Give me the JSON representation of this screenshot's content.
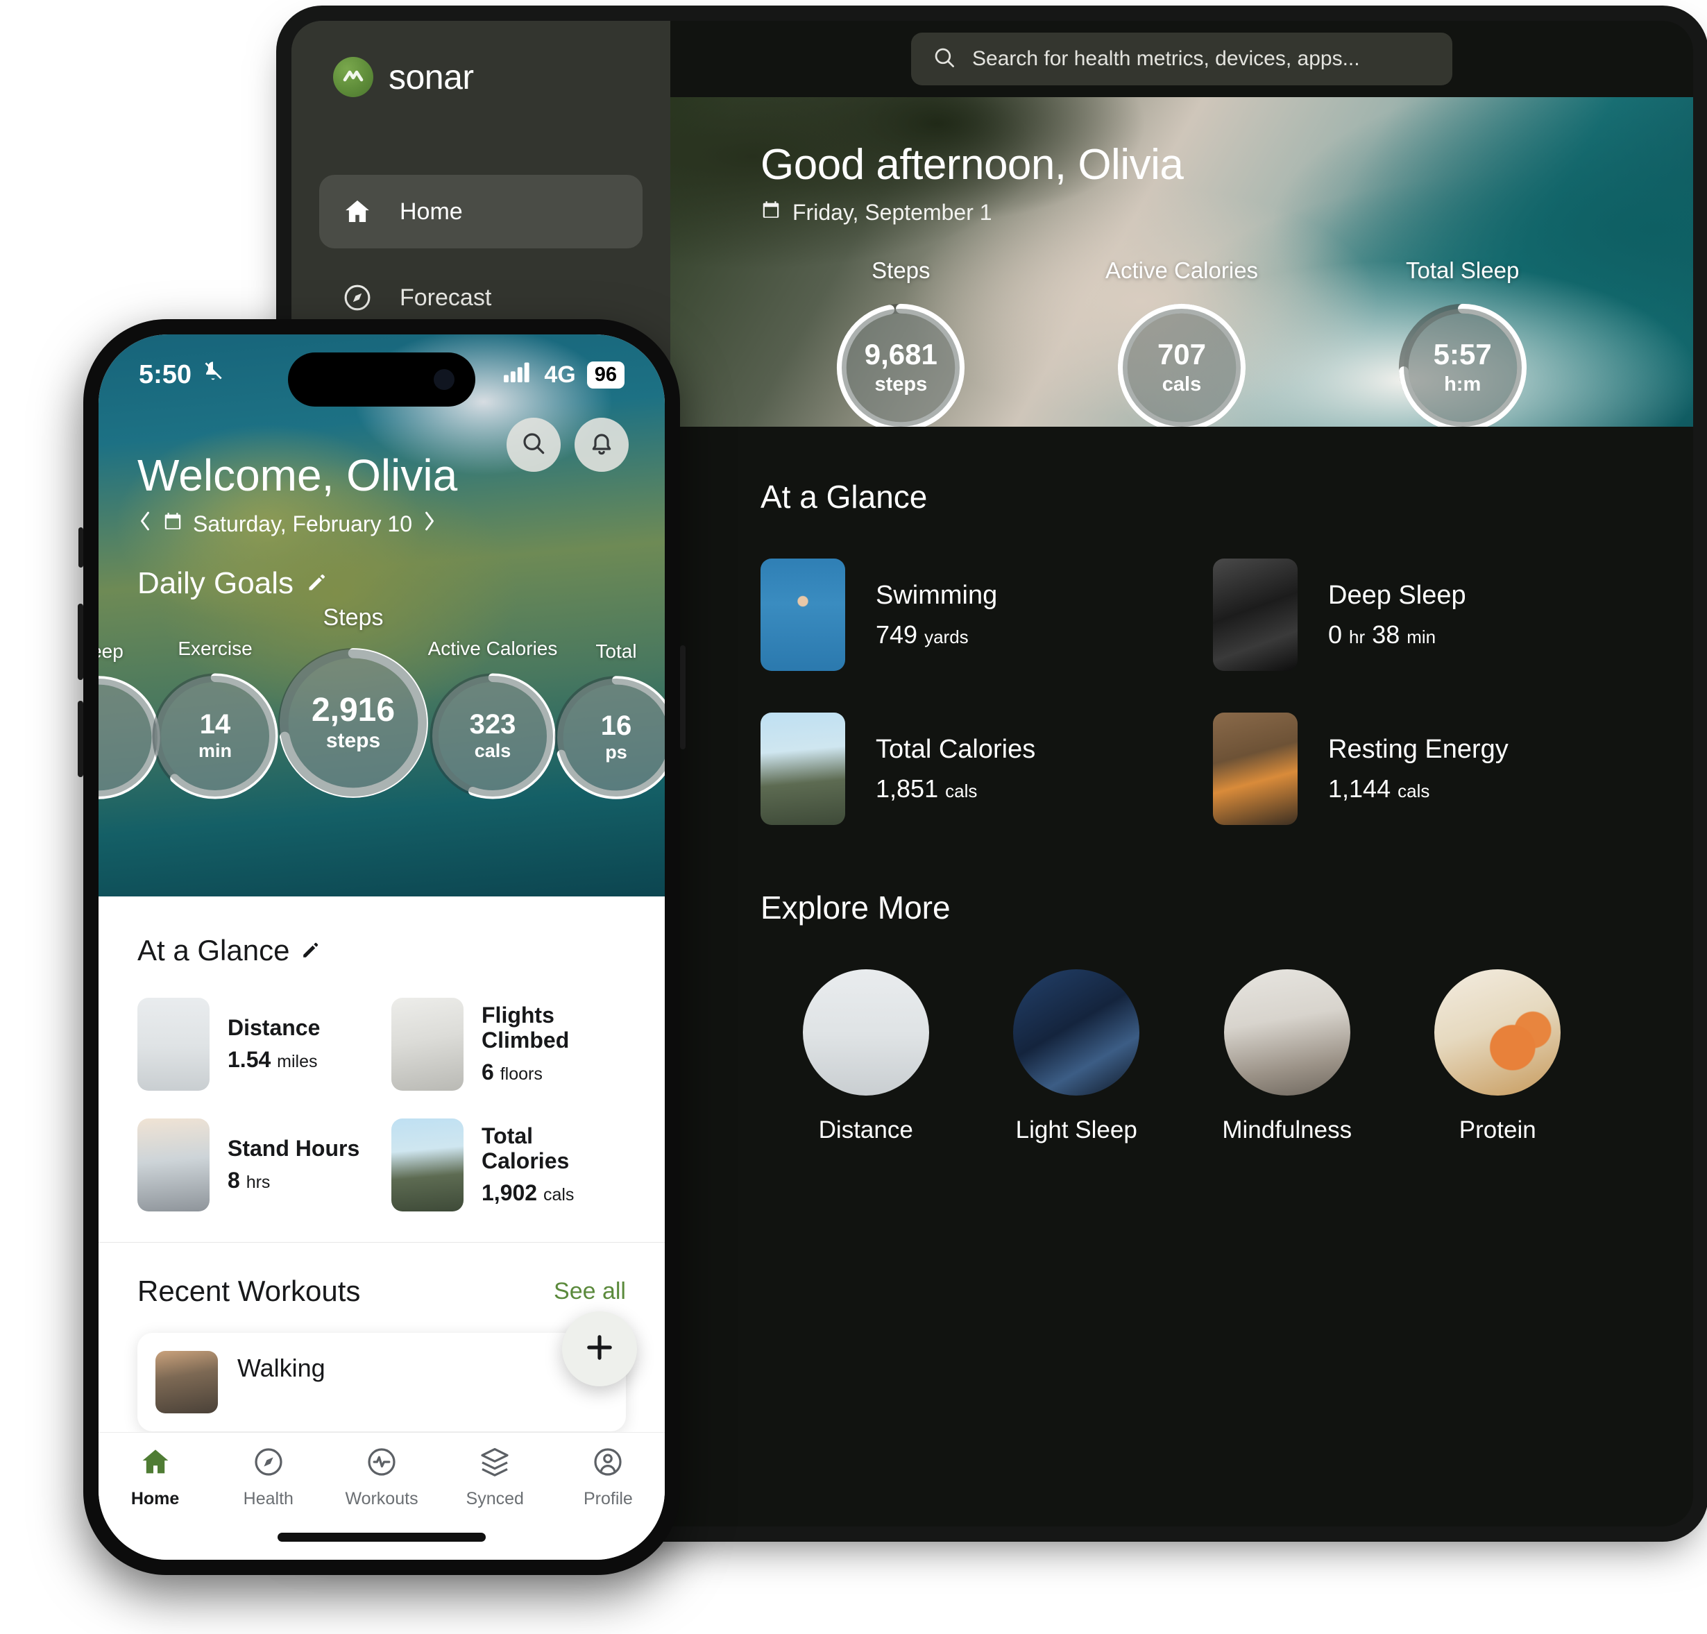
{
  "brand": {
    "name": "sonar",
    "logo_icon": "sonar-wave-icon",
    "accent": "#5c8a38"
  },
  "sidebar": {
    "items": [
      {
        "label": "Home",
        "icon": "home-icon",
        "active": true
      },
      {
        "label": "Forecast",
        "icon": "compass-icon",
        "active": false
      }
    ]
  },
  "search": {
    "placeholder": "Search for health metrics, devices, apps...",
    "icon": "search-icon"
  },
  "desktop": {
    "greeting": "Good afternoon, Olivia",
    "date": "Friday, September 1",
    "date_icon": "calendar-icon",
    "rings": [
      {
        "label": "Steps",
        "value": "9,681",
        "unit": "steps",
        "progress": 97
      },
      {
        "label": "Active Calories",
        "value": "707",
        "unit": "cals",
        "progress": 100
      },
      {
        "label": "Total Sleep",
        "value": "5:57",
        "unit": "h:m",
        "progress": 74
      }
    ],
    "glance": {
      "title": "At a Glance",
      "cards": [
        {
          "name": "Swimming",
          "value": "749",
          "unit": "yards",
          "art": "art-swim",
          "thumb_icon": "swimmer-photo"
        },
        {
          "name": "Deep Sleep",
          "value": "0",
          "unit": "hr",
          "value2": "38",
          "unit2": "min",
          "art": "art-sleep",
          "thumb_icon": "sleeping-photo"
        },
        {
          "name": "Total Calories",
          "value": "1,851",
          "unit": "cals",
          "art": "art-calories",
          "thumb_icon": "athlete-photo"
        },
        {
          "name": "Resting Energy",
          "value": "1,144",
          "unit": "cals",
          "art": "art-resting",
          "thumb_icon": "hammock-photo"
        }
      ]
    },
    "explore": {
      "title": "Explore More",
      "items": [
        {
          "label": "Distance",
          "art": "art-distance"
        },
        {
          "label": "Light Sleep",
          "art": "art-lightsleep"
        },
        {
          "label": "Mindfulness",
          "art": "art-mind"
        },
        {
          "label": "Protein",
          "art": "art-protein"
        }
      ]
    }
  },
  "phone": {
    "statusbar": {
      "time": "5:50",
      "mute_icon": "bell-slash-icon",
      "signal_icon": "signal-bars-icon",
      "network": "4G",
      "battery": "96"
    },
    "actions": [
      {
        "icon": "search-icon"
      },
      {
        "icon": "bell-icon"
      }
    ],
    "title": "Welcome, Olivia",
    "date": "Saturday, February 10",
    "date_icon": "calendar-icon",
    "date_prev_icon": "chevron-left-icon",
    "date_next_icon": "chevron-right-icon",
    "goals": {
      "title": "Daily Goals",
      "edit_icon": "pencil-icon",
      "rings": [
        {
          "label": "Sleep",
          "value": "",
          "unit": "",
          "progress": 80,
          "partial": true
        },
        {
          "label": "Exercise",
          "value": "14",
          "unit": "min",
          "progress": 62
        },
        {
          "label": "Steps",
          "value": "2,916",
          "unit": "steps",
          "progress": 72
        },
        {
          "label": "Active Calories",
          "value": "323",
          "unit": "cals",
          "progress": 55
        },
        {
          "label": "Total",
          "value": "16",
          "unit": "ps",
          "progress": 70,
          "partial": true
        }
      ]
    },
    "glance": {
      "title": "At a Glance",
      "edit_icon": "pencil-icon",
      "cards": [
        {
          "name": "Distance",
          "value": "1.54",
          "unit": "miles",
          "art": "art-distance"
        },
        {
          "name": "Flights Climbed",
          "value": "6",
          "unit": "floors",
          "art": "art-flights"
        },
        {
          "name": "Stand Hours",
          "value": "8",
          "unit": "hrs",
          "art": "art-stand"
        },
        {
          "name": "Total Calories",
          "value": "1,902",
          "unit": "cals",
          "art": "art-calories"
        }
      ]
    },
    "recent": {
      "title": "Recent Workouts",
      "see_all": "See all",
      "workout": {
        "name": "Walking",
        "art": "art-walk"
      },
      "add_icon": "plus-icon"
    },
    "nav": [
      {
        "label": "Home",
        "icon": "home-icon",
        "active": true
      },
      {
        "label": "Health",
        "icon": "compass-icon",
        "active": false
      },
      {
        "label": "Workouts",
        "icon": "pulse-icon",
        "active": false
      },
      {
        "label": "Synced",
        "icon": "layers-icon",
        "active": false
      },
      {
        "label": "Profile",
        "icon": "person-icon",
        "active": false
      }
    ]
  }
}
